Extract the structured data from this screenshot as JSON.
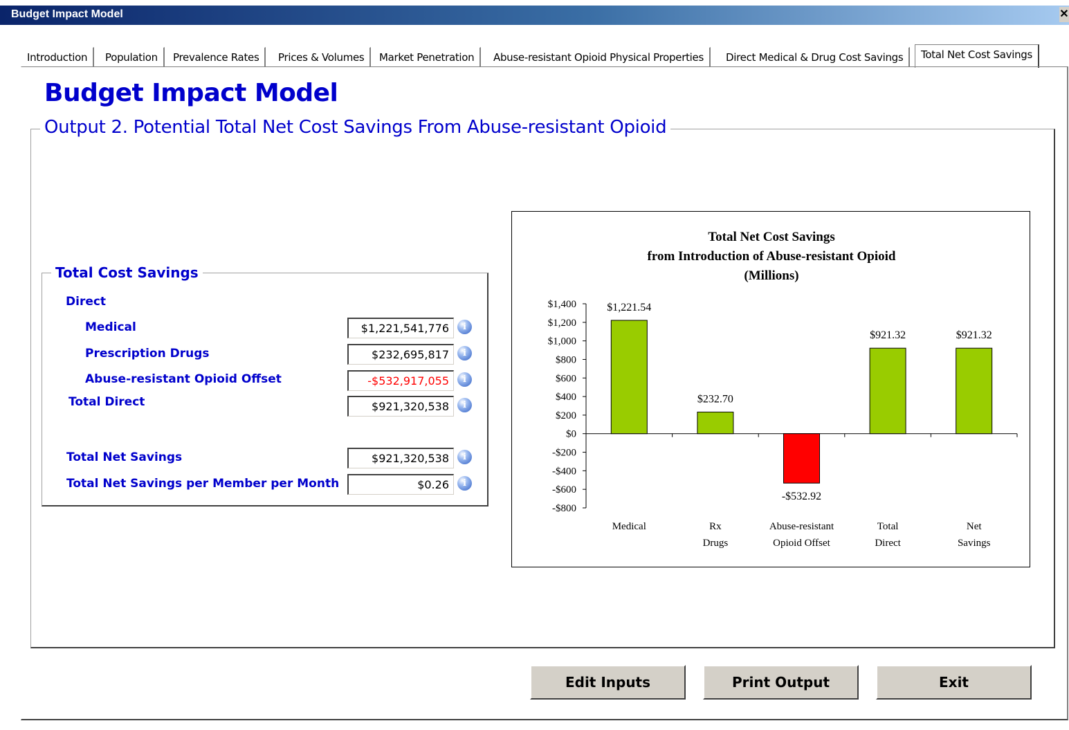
{
  "window": {
    "title": "Budget Impact Model",
    "close_label": "✕"
  },
  "tabs": [
    {
      "label": "Introduction"
    },
    {
      "label": "Population"
    },
    {
      "label": "Prevalence Rates"
    },
    {
      "label": "Prices & Volumes"
    },
    {
      "label": "Market Penetration"
    },
    {
      "label": "Abuse-resistant Opioid Physical Properties"
    },
    {
      "label": "Direct Medical & Drug Cost Savings"
    },
    {
      "label": "Total Net Cost Savings",
      "active": true
    }
  ],
  "page": {
    "title": "Budget Impact Model",
    "output_title": "Output 2. Potential Total Net Cost Savings From Abuse-resistant Opioid"
  },
  "cost_savings": {
    "title": "Total Cost Savings",
    "direct_label": "Direct",
    "medical": {
      "label": "Medical",
      "value": "$1,221,541,776"
    },
    "prescription_drugs": {
      "label": "Prescription Drugs",
      "value": "$232,695,817"
    },
    "opioid_offset": {
      "label": "Abuse-resistant Opioid Offset",
      "value": "-$532,917,055"
    },
    "total_direct": {
      "label": "Total Direct",
      "value": "$921,320,538"
    },
    "total_net_savings": {
      "label": "Total Net Savings",
      "value": "$921,320,538"
    },
    "per_member_month": {
      "label": "Total Net Savings per Member per Month",
      "value": "$0.26"
    },
    "info_icon": "i"
  },
  "chart_data": {
    "type": "bar",
    "title_lines": [
      "Total Net Cost Savings",
      "from Introduction of Abuse-resistant Opioid",
      "(Millions)"
    ],
    "categories": [
      [
        "Medical"
      ],
      [
        "Rx",
        "Drugs"
      ],
      [
        "Abuse-resistant",
        "Opioid Offset"
      ],
      [
        "Total",
        "Direct"
      ],
      [
        "Net",
        "Savings"
      ]
    ],
    "values": [
      1221.54,
      232.7,
      -532.92,
      921.32,
      921.32
    ],
    "value_labels": [
      "$1,221.54",
      "$232.70",
      "-$532.92",
      "$921.32",
      "$921.32"
    ],
    "yticks": [
      "$1,400",
      "$1,200",
      "$1,000",
      "$800",
      "$600",
      "$400",
      "$200",
      "$0",
      "-$200",
      "-$400",
      "-$600",
      "-$800"
    ],
    "ylim": [
      -800,
      1400
    ],
    "colors": {
      "positive": "#99cc00",
      "negative": "#ff0000"
    },
    "legend": "none",
    "grid": false
  },
  "buttons": {
    "edit": "Edit Inputs",
    "print": "Print Output",
    "exit": "Exit"
  }
}
